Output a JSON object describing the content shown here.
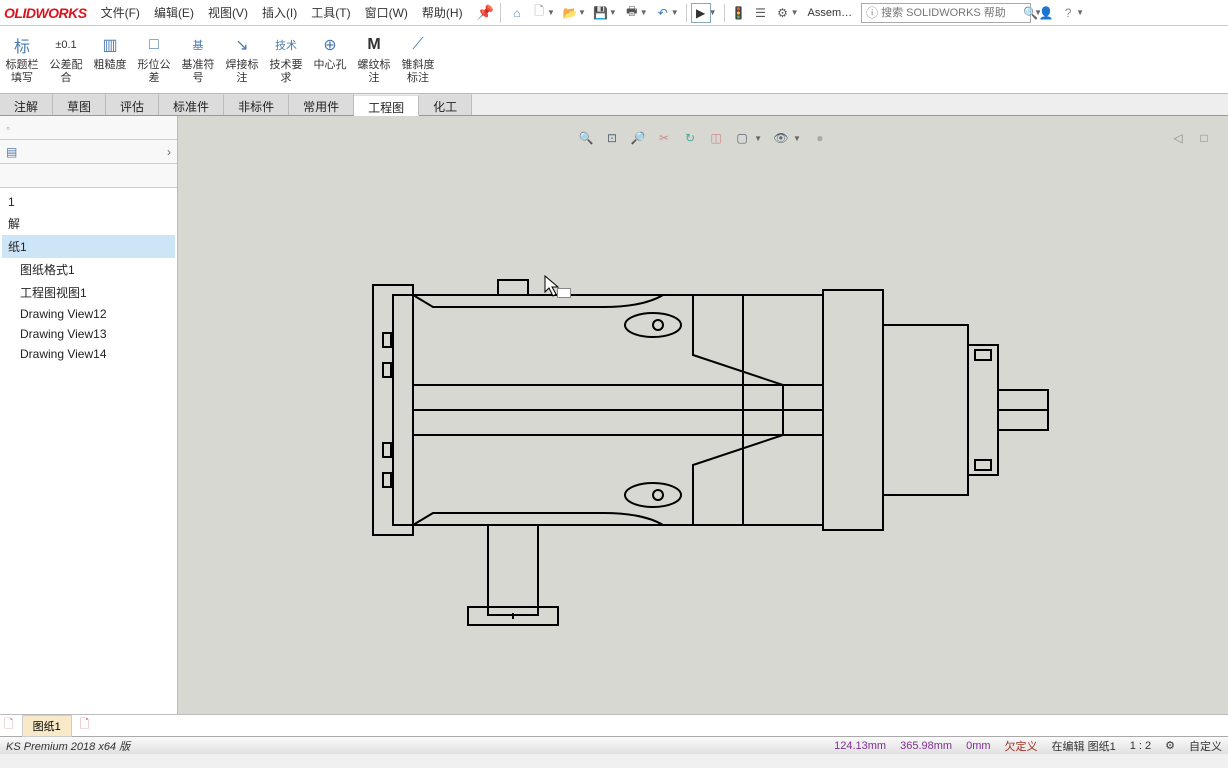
{
  "logo": "OLIDWORKS",
  "menu": {
    "file": "文件(F)",
    "edit": "编辑(E)",
    "view": "视图(V)",
    "insert": "插入(I)",
    "tools": "工具(T)",
    "window": "窗口(W)",
    "help": "帮助(H)"
  },
  "toolbar": {
    "assem": "Assem…",
    "search_placeholder": "搜索 SOLIDWORKS 帮助"
  },
  "ribbon": {
    "r0": {
      "icon": "标",
      "label": "标题栏填写"
    },
    "r1": {
      "icon": "±0.1",
      "label": "公差配合"
    },
    "r2": {
      "icon": "▥",
      "label": "粗糙度"
    },
    "r3": {
      "icon": "□",
      "label": "形位公差"
    },
    "r4": {
      "icon": "基",
      "label": "基准符号"
    },
    "r5": {
      "icon": "↘",
      "label": "焊接标注"
    },
    "r6": {
      "icon": "技术",
      "label": "技术要求"
    },
    "r7": {
      "icon": "⊕",
      "label": "中心孔"
    },
    "r8": {
      "icon": "M",
      "label": "螺纹标注"
    },
    "r9": {
      "icon": "⟋",
      "label": "锥斜度标注"
    }
  },
  "tabs": {
    "t0": "注解",
    "t1": "草图",
    "t2": "评估",
    "t3": "标准件",
    "t4": "非标件",
    "t5": "常用件",
    "t6": "工程图",
    "t7": "化工"
  },
  "tree": {
    "item0": "1",
    "item1": "解",
    "item2": "纸1",
    "item3": "图纸格式1",
    "item4": "工程图视图1",
    "item5": "Drawing View12",
    "item6": "Drawing View13",
    "item7": "Drawing View14"
  },
  "sheet": {
    "tab0": "图纸1"
  },
  "status": {
    "left": "KS Premium 2018 x64 版",
    "coord1": "124.13mm",
    "coord2": "365.98mm",
    "coord3": "0mm",
    "state": "欠定义",
    "editing": "在编辑 图纸1",
    "scale": "1 : 2",
    "custom": "自定义"
  }
}
